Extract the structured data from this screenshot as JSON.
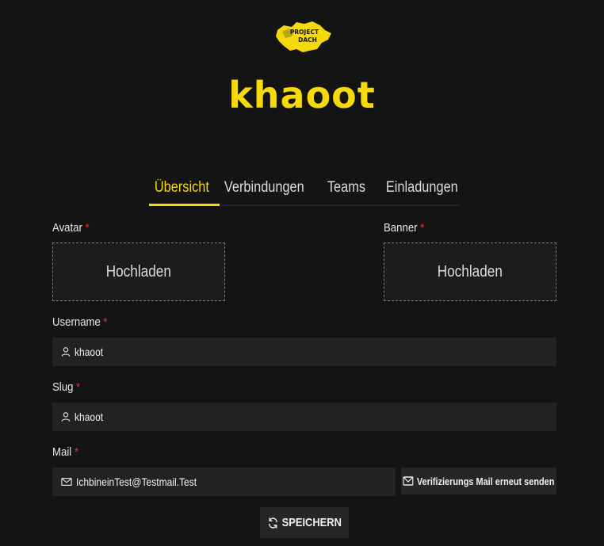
{
  "logo": {
    "text_line1": "PROJECT",
    "text_line2": "DACH",
    "color": "#f5d90a"
  },
  "title": "khaoot",
  "tabs": [
    {
      "label": "Übersicht",
      "active": true
    },
    {
      "label": "Verbindungen",
      "active": false
    },
    {
      "label": "Teams",
      "active": false
    },
    {
      "label": "Einladungen",
      "active": false
    }
  ],
  "avatar": {
    "label": "Avatar",
    "required": "*",
    "upload_label": "Hochladen"
  },
  "banner": {
    "label": "Banner",
    "required": "*",
    "upload_label": "Hochladen"
  },
  "username": {
    "label": "Username",
    "required": "*",
    "value": "khaoot",
    "icon": "user-icon"
  },
  "slug": {
    "label": "Slug",
    "required": "*",
    "value": "khaoot",
    "icon": "user-icon"
  },
  "mail": {
    "label": "Mail",
    "required": "*",
    "value": "IchbineinTest@Testmail.Test",
    "icon": "mail-icon"
  },
  "verify_button": {
    "label": "Verifizierungs Mail erneut senden",
    "icon": "mail-icon"
  },
  "save_button": {
    "label": "SPEICHERN",
    "icon": "refresh-icon"
  },
  "colors": {
    "accent": "#f5d90a",
    "background": "#141414",
    "field": "#222222",
    "required": "#e03131"
  }
}
